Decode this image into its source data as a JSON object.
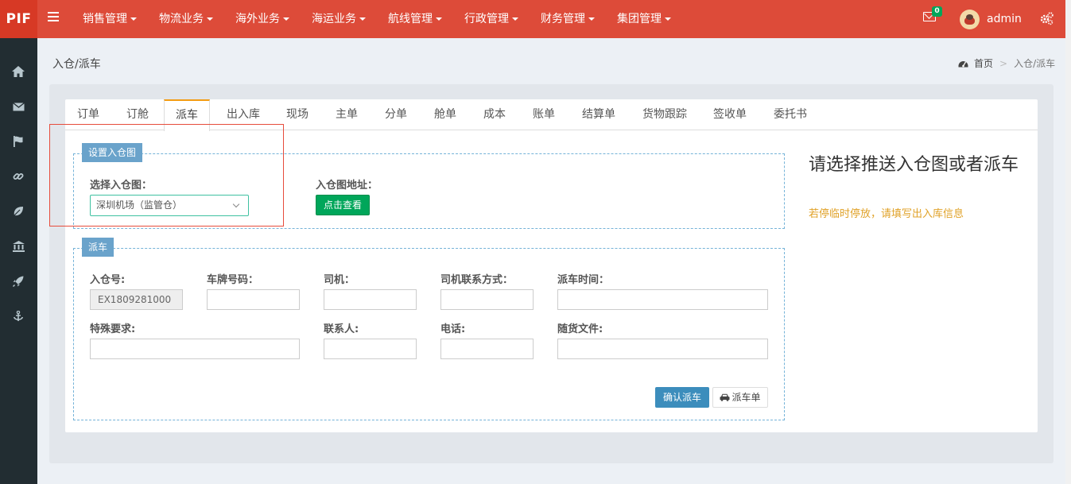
{
  "app": {
    "logo": "PIF"
  },
  "topnav": [
    {
      "label": "销售管理"
    },
    {
      "label": "物流业务"
    },
    {
      "label": "海外业务"
    },
    {
      "label": "海运业务"
    },
    {
      "label": "航线管理"
    },
    {
      "label": "行政管理"
    },
    {
      "label": "财务管理"
    },
    {
      "label": "集团管理"
    }
  ],
  "header": {
    "mail_count": "0",
    "user": "admin"
  },
  "sidebar": {
    "icons": [
      "home-icon",
      "envelope-icon",
      "flag-icon",
      "link-icon",
      "leaf-icon",
      "bank-icon",
      "rocket-icon",
      "anchor-icon"
    ]
  },
  "page": {
    "title": "入仓/派车",
    "breadcrumb": {
      "home": "首页",
      "current": "入仓/派车"
    }
  },
  "tabs": [
    {
      "label": "订单"
    },
    {
      "label": "订舱"
    },
    {
      "label": "派车",
      "active": true
    },
    {
      "label": "出入库"
    },
    {
      "label": "现场"
    },
    {
      "label": "主单"
    },
    {
      "label": "分单"
    },
    {
      "label": "舱单"
    },
    {
      "label": "成本"
    },
    {
      "label": "账单"
    },
    {
      "label": "结算单"
    },
    {
      "label": "货物跟踪"
    },
    {
      "label": "签收单"
    },
    {
      "label": "委托书"
    }
  ],
  "warehouse": {
    "legend": "设置入仓图",
    "select_label": "选择入仓图：",
    "select_value": "深圳机场（监管仓）",
    "address_label": "入仓图地址：",
    "view_button": "点击查看"
  },
  "dispatch": {
    "legend": "派车",
    "fields": {
      "inbound_no": {
        "label": "入仓号:",
        "value": "EX1809281000"
      },
      "plate": {
        "label": "车牌号码：",
        "value": ""
      },
      "driver": {
        "label": "司机：",
        "value": ""
      },
      "driver_contact": {
        "label": "司机联系方式：",
        "value": ""
      },
      "dispatch_time": {
        "label": "派车时间：",
        "value": ""
      },
      "special": {
        "label": "特殊要求:",
        "value": ""
      },
      "contact": {
        "label": "联系人:",
        "value": ""
      },
      "phone": {
        "label": "电话:",
        "value": ""
      },
      "documents": {
        "label": "随货文件:",
        "value": ""
      }
    },
    "confirm_button": "确认派车",
    "sheet_button": "派车单"
  },
  "notice": {
    "title": "请选择推送入仓图或者派车",
    "tip": "若停临时停放，请填写出入库信息"
  },
  "colors": {
    "topbar": "#dd4b39",
    "sidebar": "#222d32",
    "accent_tab": "#f39c12",
    "legend": "#6aa3cb",
    "green": "#00a65a",
    "blue": "#3c8dbc",
    "highlight": "#e74c3c",
    "tip": "#e0a228"
  }
}
